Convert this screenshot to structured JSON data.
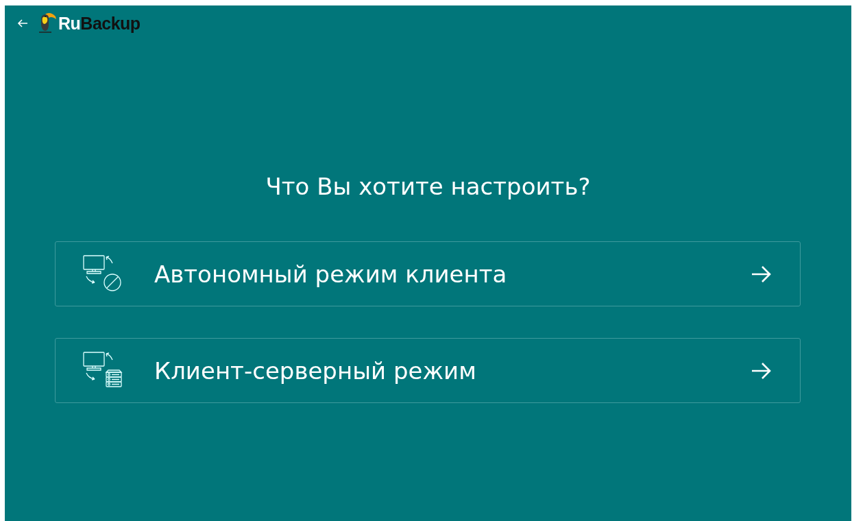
{
  "header": {
    "logo": {
      "prefix": "Ru",
      "suffix": "Backup"
    }
  },
  "question": "Что Вы хотите настроить?",
  "options": [
    {
      "kind": "offline",
      "label": "Автономный режим клиента"
    },
    {
      "kind": "client-server",
      "label": "Клиент-серверный режим"
    }
  ]
}
